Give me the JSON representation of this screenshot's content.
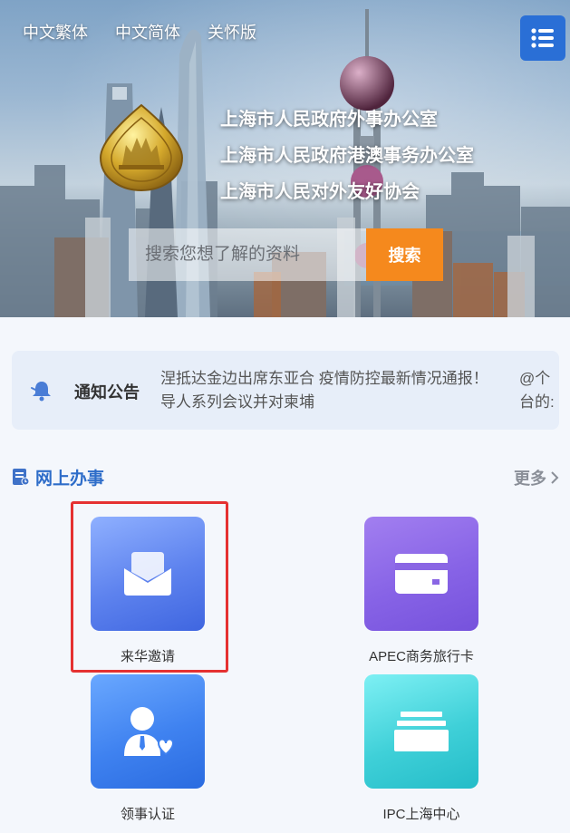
{
  "header": {
    "languages": [
      "中文繁体",
      "中文简体",
      "关怀版"
    ],
    "menu_icon": "list-menu-icon",
    "emblem_icon": "shanghai-emblem-icon",
    "org_titles": [
      "上海市人民政府外事办公室",
      "上海市人民政府港澳事务办公室",
      "上海市人民对外友好协会"
    ],
    "search": {
      "placeholder": "搜索您想了解的资料",
      "button_label": "搜索"
    }
  },
  "notice": {
    "icon": "bell-icon",
    "label": "通知公告",
    "lines": [
      "涅抵达金边出席东亚合 疫情防控最新情况通报！",
      "导人系列会议并对柬埔"
    ],
    "tail_lines": [
      "@个",
      "台的:"
    ]
  },
  "online_services": {
    "icon": "document-icon",
    "title": "网上办事",
    "more_label": "更多",
    "items": [
      {
        "label": "来华邀请",
        "icon": "envelope-icon"
      },
      {
        "label": "APEC商务旅行卡",
        "icon": "card-icon"
      },
      {
        "label": "领事认证",
        "icon": "consul-person-icon"
      },
      {
        "label": "IPC上海中心",
        "icon": "stack-icon"
      }
    ]
  },
  "colors": {
    "accent_blue": "#2e6dc9",
    "search_button": "#f5891d",
    "highlight_border": "#e53131"
  }
}
